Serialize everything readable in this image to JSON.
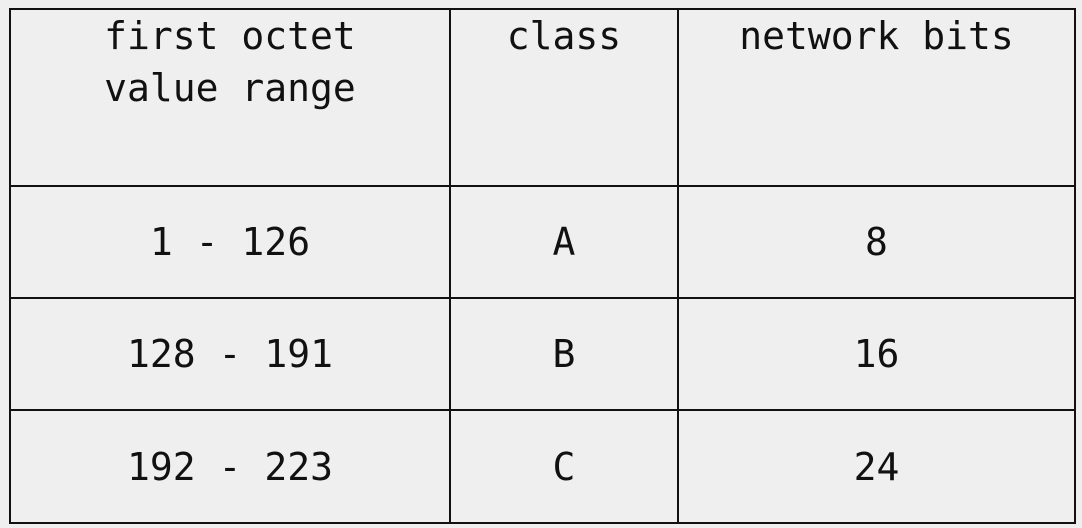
{
  "table": {
    "headers": [
      {
        "line1": "first octet",
        "line2": "value range"
      },
      {
        "line1": "class",
        "line2": ""
      },
      {
        "line1": "network bits",
        "line2": ""
      }
    ],
    "rows": [
      {
        "range": "1 - 126",
        "class": "A",
        "network_bits": "8"
      },
      {
        "range": "128 - 191",
        "class": "B",
        "network_bits": "16"
      },
      {
        "range": "192 - 223",
        "class": "C",
        "network_bits": "24"
      }
    ]
  }
}
